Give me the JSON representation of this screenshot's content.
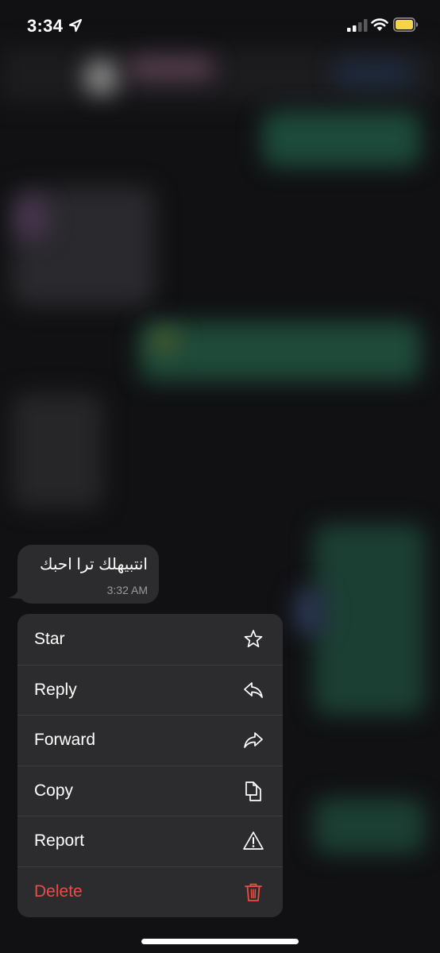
{
  "status_bar": {
    "time": "3:34",
    "battery_color": "#f5d34a"
  },
  "message": {
    "text": "انتبيهلك ترا احبك",
    "time": "3:32 AM"
  },
  "context_menu": {
    "items": [
      {
        "label": "Star",
        "icon": "star-icon"
      },
      {
        "label": "Reply",
        "icon": "reply-icon"
      },
      {
        "label": "Forward",
        "icon": "forward-icon"
      },
      {
        "label": "Copy",
        "icon": "copy-icon"
      },
      {
        "label": "Report",
        "icon": "warning-icon"
      },
      {
        "label": "Delete",
        "icon": "trash-icon",
        "color": "#eb4d43"
      }
    ]
  }
}
